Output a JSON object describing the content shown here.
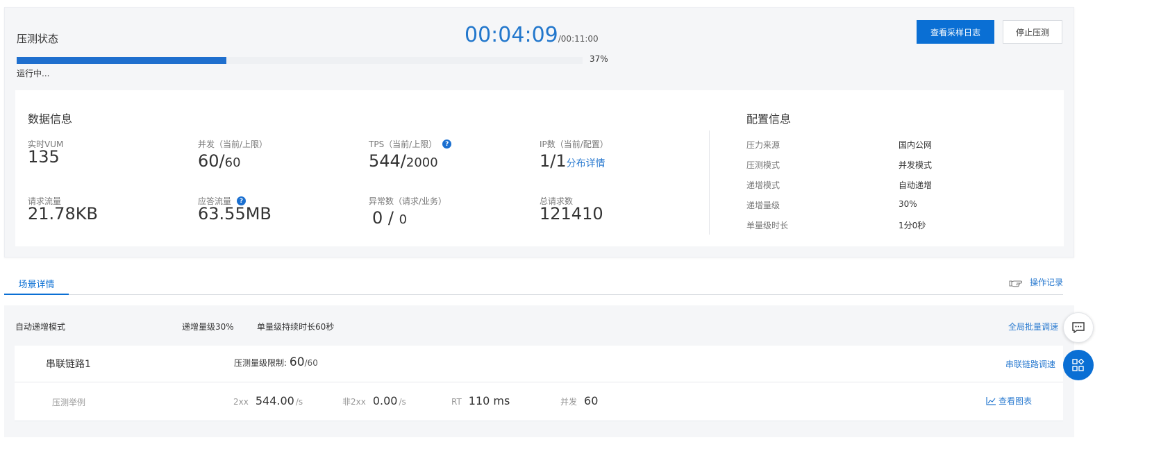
{
  "status": {
    "title": "压测状态",
    "timer_current": "00:04:09",
    "timer_total": "/00:11:00",
    "progress_percent": 37,
    "progress_label": "37%",
    "run_state": "运行中...",
    "view_log_button": "查看采样日志",
    "stop_button": "停止压测"
  },
  "data_info": {
    "title": "数据信息",
    "vum_label": "实时VUM",
    "vum_value": "135",
    "concurrency_label": "并发（当前/上限）",
    "concurrency_current": "60/",
    "concurrency_max": "60",
    "tps_label": "TPS（当前/上限）",
    "tps_current": "544/",
    "tps_max": "2000",
    "ip_label": "IP数（当前/配置）",
    "ip_value": "1/1",
    "ip_link": "分布详情",
    "request_traffic_label": "请求流量",
    "request_traffic_value": "21.78KB",
    "response_traffic_label": "应答流量",
    "response_traffic_value": "63.55MB",
    "exceptions_label": "异常数（请求/业务）",
    "exceptions_request": "0 /",
    "exceptions_business": "0",
    "total_requests_label": "总请求数",
    "total_requests_value": "121410"
  },
  "config_info": {
    "title": "配置信息",
    "items": [
      {
        "label": "压力来源",
        "value": "国内公网"
      },
      {
        "label": "压测模式",
        "value": "并发模式"
      },
      {
        "label": "递增模式",
        "value": "自动递增"
      },
      {
        "label": "递增量级",
        "value": "30%"
      },
      {
        "label": "单量级时长",
        "value": "1分0秒"
      }
    ]
  },
  "tabs": {
    "scene_detail": "场景详情",
    "operation_log": "操作记录"
  },
  "scene": {
    "mode": "自动递增模式",
    "increment": "递增量级30%",
    "duration": "单量级持续时长60秒",
    "batch_adjust": "全局批量调速",
    "chain_name": "串联链路1",
    "chain_limit_label": "压测量级限制:",
    "chain_limit_value": "60",
    "chain_limit_max": "/60",
    "chain_adjust": "串联链路调速",
    "detail_name": "压测举例",
    "stat_2xx_label": "2xx",
    "stat_2xx_value": "544.00",
    "stat_2xx_unit": "/s",
    "stat_non2xx_label": "非2xx",
    "stat_non2xx_value": "0.00",
    "stat_non2xx_unit": "/s",
    "stat_rt_label": "RT",
    "stat_rt_value": "110 ms",
    "stat_conc_label": "并发",
    "stat_conc_value": "60",
    "view_chart": "查看图表"
  },
  "icons": {
    "help": "question-circle-icon",
    "operation_log": "pointing-hand-icon",
    "chart": "line-chart-icon",
    "chat": "chat-bubble-icon",
    "apps": "apps-grid-icon"
  },
  "colors": {
    "primary": "#0a6fd4",
    "link": "#2b7bd0",
    "timer": "#2277cc"
  }
}
